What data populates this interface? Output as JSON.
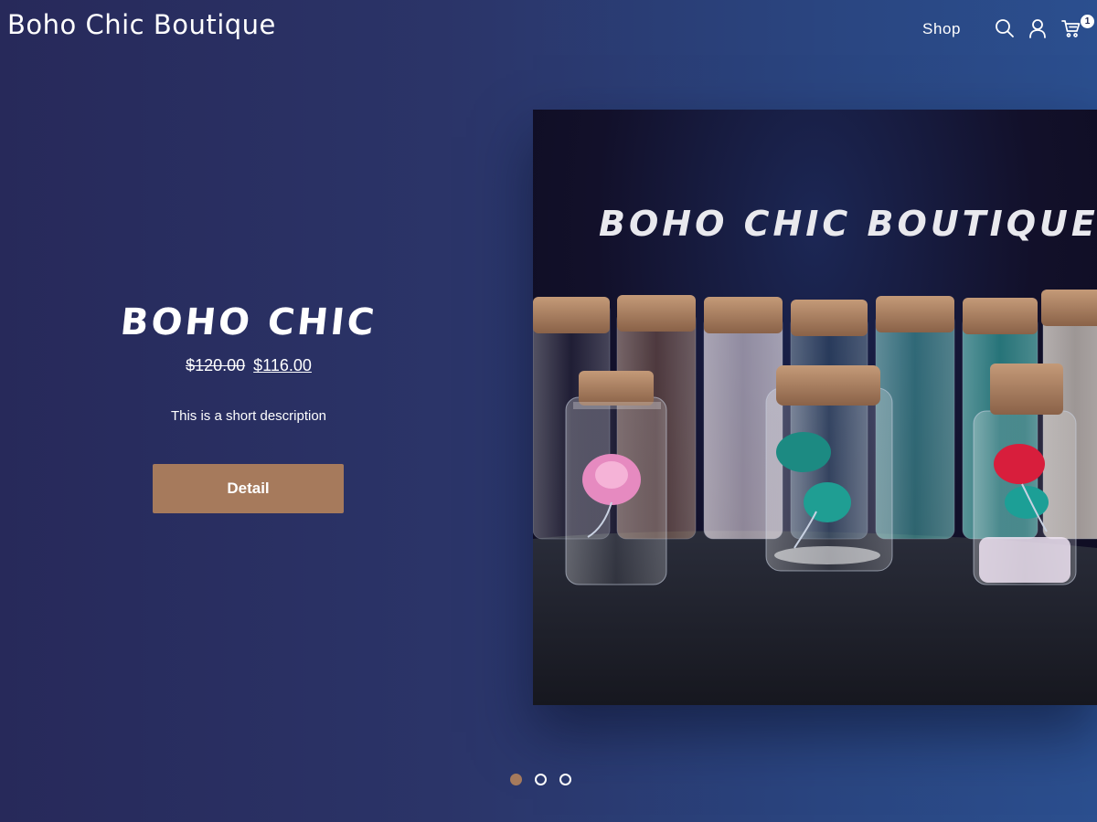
{
  "header": {
    "brand": "Boho Chic Boutique",
    "nav": [
      {
        "label": "Shop"
      }
    ],
    "icons": [
      "search-icon",
      "user-icon",
      "cart-icon"
    ],
    "cart_count": "1"
  },
  "hero": {
    "title": "BOHO CHIC",
    "price_old": "$120.00",
    "price_new": "$116.00",
    "description": "This is a short description",
    "button_label": "Detail",
    "image": {
      "overlay_text": "BOHO CHIC BOUTIQUE"
    }
  },
  "carousel": {
    "slide_count": 3,
    "active_index": 0
  },
  "colors": {
    "accent": "#a67a5c",
    "background_start": "#27295a",
    "background_end": "#2b4f8f",
    "text": "#ffffff"
  }
}
